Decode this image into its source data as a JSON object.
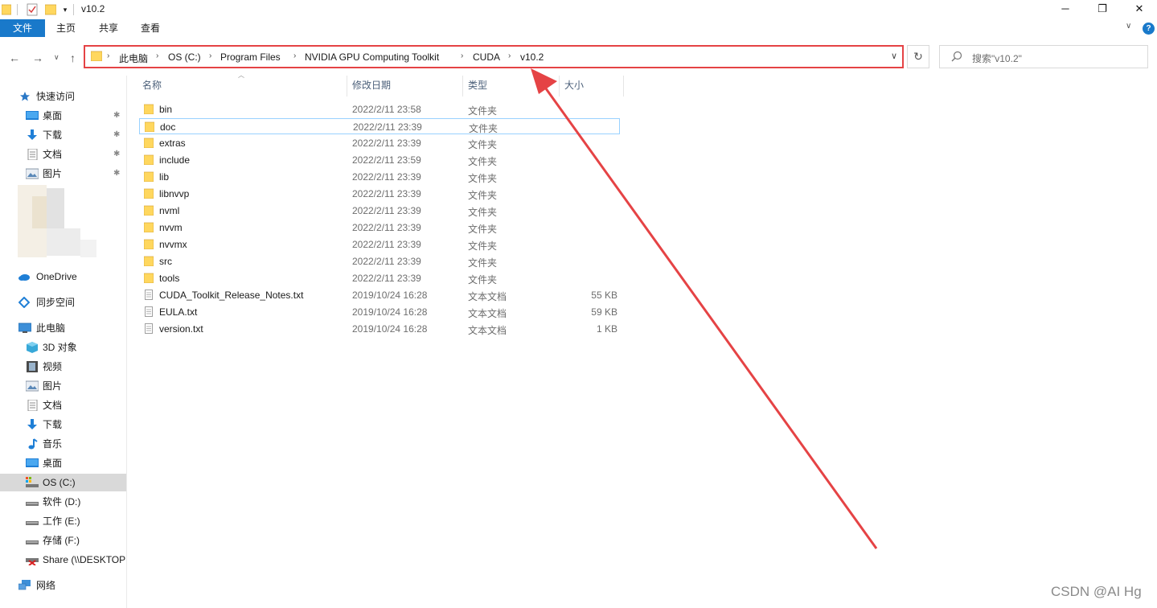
{
  "window": {
    "title": "v10.2",
    "minimize": "─",
    "maximize": "❐",
    "close": "✕"
  },
  "ribbon": {
    "tabs": [
      "文件",
      "主页",
      "共享",
      "查看"
    ],
    "help": "?",
    "expand": "∨"
  },
  "nav": {
    "back": "←",
    "forward": "→",
    "recent": "∨",
    "up": "↑"
  },
  "address": {
    "crumbs": [
      "此电脑",
      "OS (C:)",
      "Program Files",
      "NVIDIA GPU Computing Toolkit",
      "CUDA",
      "v10.2"
    ],
    "separator": "›",
    "dropdown": "∨"
  },
  "refresh": "↻",
  "search": {
    "placeholder": "搜索\"v10.2\"",
    "icon": "search-icon"
  },
  "sidebar": {
    "quick_access": "快速访问",
    "quick_items": [
      {
        "label": "桌面",
        "icon": "desktop-icon"
      },
      {
        "label": "下载",
        "icon": "download-icon"
      },
      {
        "label": "文档",
        "icon": "document-icon"
      },
      {
        "label": "图片",
        "icon": "pictures-icon"
      }
    ],
    "pin": "📌",
    "onedrive": "OneDrive",
    "sync": "同步空间",
    "this_pc": "此电脑",
    "pc_items": [
      {
        "label": "3D 对象",
        "icon": "3d-objects-icon"
      },
      {
        "label": "视频",
        "icon": "videos-icon"
      },
      {
        "label": "图片",
        "icon": "pictures-icon"
      },
      {
        "label": "文档",
        "icon": "document-icon"
      },
      {
        "label": "下载",
        "icon": "download-icon"
      },
      {
        "label": "音乐",
        "icon": "music-icon"
      },
      {
        "label": "桌面",
        "icon": "desktop-icon"
      },
      {
        "label": "OS (C:)",
        "icon": "os-drive-icon"
      },
      {
        "label": "软件 (D:)",
        "icon": "drive-icon"
      },
      {
        "label": "工作 (E:)",
        "icon": "drive-icon"
      },
      {
        "label": "存储 (F:)",
        "icon": "drive-icon"
      },
      {
        "label": "Share (\\\\DESKTOP",
        "icon": "network-drive-icon"
      }
    ],
    "network": "网络",
    "selected": "OS (C:)"
  },
  "columns": {
    "name": "名称",
    "date": "修改日期",
    "type": "类型",
    "size": "大小"
  },
  "files": [
    {
      "name": "bin",
      "date": "2022/2/11 23:58",
      "type": "文件夹",
      "size": "",
      "kind": "folder"
    },
    {
      "name": "doc",
      "date": "2022/2/11 23:39",
      "type": "文件夹",
      "size": "",
      "kind": "folder"
    },
    {
      "name": "extras",
      "date": "2022/2/11 23:39",
      "type": "文件夹",
      "size": "",
      "kind": "folder"
    },
    {
      "name": "include",
      "date": "2022/2/11 23:59",
      "type": "文件夹",
      "size": "",
      "kind": "folder"
    },
    {
      "name": "lib",
      "date": "2022/2/11 23:39",
      "type": "文件夹",
      "size": "",
      "kind": "folder"
    },
    {
      "name": "libnvvp",
      "date": "2022/2/11 23:39",
      "type": "文件夹",
      "size": "",
      "kind": "folder"
    },
    {
      "name": "nvml",
      "date": "2022/2/11 23:39",
      "type": "文件夹",
      "size": "",
      "kind": "folder"
    },
    {
      "name": "nvvm",
      "date": "2022/2/11 23:39",
      "type": "文件夹",
      "size": "",
      "kind": "folder"
    },
    {
      "name": "nvvmx",
      "date": "2022/2/11 23:39",
      "type": "文件夹",
      "size": "",
      "kind": "folder"
    },
    {
      "name": "src",
      "date": "2022/2/11 23:39",
      "type": "文件夹",
      "size": "",
      "kind": "folder"
    },
    {
      "name": "tools",
      "date": "2022/2/11 23:39",
      "type": "文件夹",
      "size": "",
      "kind": "folder"
    },
    {
      "name": "CUDA_Toolkit_Release_Notes.txt",
      "date": "2019/10/24 16:28",
      "type": "文本文档",
      "size": "55 KB",
      "kind": "text"
    },
    {
      "name": "EULA.txt",
      "date": "2019/10/24 16:28",
      "type": "文本文档",
      "size": "59 KB",
      "kind": "text"
    },
    {
      "name": "version.txt",
      "date": "2019/10/24 16:28",
      "type": "文本文档",
      "size": "1 KB",
      "kind": "text"
    }
  ],
  "focused_row": "doc",
  "watermark": "CSDN @AI Hg",
  "colors": {
    "accent": "#1979ca",
    "annotation": "#e54345",
    "folder": "#ffd75e",
    "selection": "#d9d9d9",
    "focus_border": "#99d1ff"
  }
}
